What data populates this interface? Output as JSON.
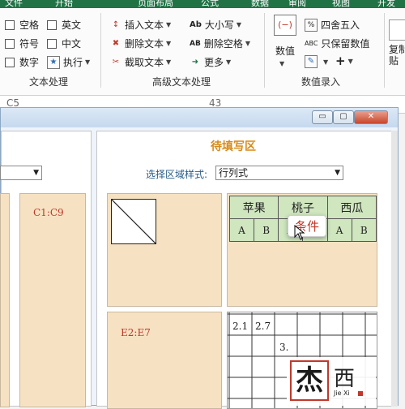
{
  "ribbon": {
    "tabs": [
      "文件",
      "开始",
      "页面布局",
      "公式",
      "数据",
      "审阅",
      "视图",
      "开发"
    ],
    "text_group": {
      "items": [
        {
          "label": "空格",
          "checked": false
        },
        {
          "label": "英文",
          "checked": false
        },
        {
          "label": "符号",
          "checked": false
        },
        {
          "label": "中文",
          "checked": false
        },
        {
          "label": "数字",
          "checked": false
        }
      ],
      "execute_label": "执行",
      "group_label": "文本处理"
    },
    "advanced_group": {
      "insert_label": "插入文本",
      "delete_label": "删除文本",
      "cut_label": "截取文本",
      "case_label": "大小写",
      "remove_space_label": "删除空格",
      "more_label": "更多",
      "case_icon_text": "Ab",
      "remove_space_icon_text": "AB",
      "group_label": "高级文本处理"
    },
    "number_group": {
      "value_label": "数值",
      "round_label": "四舍五入",
      "keep_value_label": "只保留数值",
      "keep_value_icon_text": "ABC",
      "plus_label": "+",
      "group_label": "数值录入"
    },
    "paste_label": "复制贴"
  },
  "formula_bar": {
    "cell_ref": "C5",
    "value": "43"
  },
  "dialog": {
    "min_label": "▭",
    "max_label": "▢",
    "close_label": "✕",
    "right_panel": {
      "title": "待填写区",
      "select_label": "选择区域样式:",
      "select_value": "行列式",
      "range1": "C1:C9",
      "range2": "E2:E7",
      "table": {
        "headers": [
          "苹果",
          "桃子",
          "西瓜"
        ],
        "subheaders": [
          "A",
          "B",
          "A",
          "B",
          "A",
          "B"
        ]
      },
      "tooltip": "条件",
      "grid_values": [
        "2.1",
        "2.7",
        "3."
      ]
    }
  },
  "watermark": {
    "char1": "杰",
    "char2": "西",
    "sub": "Jie Xi"
  }
}
